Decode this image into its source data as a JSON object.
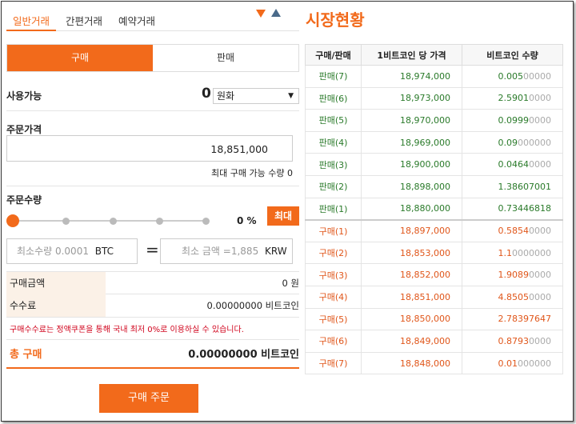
{
  "tabs": [
    {
      "label": "일반거래",
      "active": true
    },
    {
      "label": "간편거래",
      "active": false
    },
    {
      "label": "예약거래",
      "active": false
    }
  ],
  "side_tabs": {
    "buy": "구매",
    "sell": "판매"
  },
  "available": {
    "label": "사용가능",
    "value": "0",
    "currency": "원화"
  },
  "price": {
    "label": "주문가격",
    "value": "18,851,000",
    "max_qty_text": "최대 구매 가능 수량 0"
  },
  "quantity": {
    "label": "주문수량",
    "percent": "0 %",
    "max_button": "최대"
  },
  "min_qty": {
    "placeholder": "최소수량 0.0001",
    "unit": "BTC"
  },
  "min_amount": {
    "placeholder": "최소 금액 =1,885",
    "unit": "KRW"
  },
  "equals": "=",
  "summary": {
    "amount_label": "구매금액",
    "amount_value": "0 원",
    "fee_label": "수수료",
    "fee_value": "0.00000000 비트코인",
    "notice": "구매수수료는 정액쿠폰을 통해 국내 최저 0%로 이용하실 수 있습니다.",
    "total_label": "총 구매",
    "total_value": "0.00000000 비트코인"
  },
  "order_button": "구매 주문",
  "market": {
    "title": "시장현황",
    "headers": [
      "구매/판매",
      "1비트코인 당 가격",
      "비트코인 수량"
    ],
    "sells": [
      {
        "side": "판매(7)",
        "price": "18,974,000",
        "qty": "0.005",
        "qty_dim": "00000"
      },
      {
        "side": "판매(6)",
        "price": "18,973,000",
        "qty": "2.5901",
        "qty_dim": "0000"
      },
      {
        "side": "판매(5)",
        "price": "18,970,000",
        "qty": "0.0999",
        "qty_dim": "0000"
      },
      {
        "side": "판매(4)",
        "price": "18,969,000",
        "qty": "0.09",
        "qty_dim": "000000"
      },
      {
        "side": "판매(3)",
        "price": "18,900,000",
        "qty": "0.0464",
        "qty_dim": "0000"
      },
      {
        "side": "판매(2)",
        "price": "18,898,000",
        "qty": "1.38607001",
        "qty_dim": ""
      },
      {
        "side": "판매(1)",
        "price": "18,880,000",
        "qty": "0.73446818",
        "qty_dim": ""
      }
    ],
    "buys": [
      {
        "side": "구매(1)",
        "price": "18,897,000",
        "qty": "0.5854",
        "qty_dim": "0000"
      },
      {
        "side": "구매(2)",
        "price": "18,853,000",
        "qty": "1.1",
        "qty_dim": "0000000"
      },
      {
        "side": "구매(3)",
        "price": "18,852,000",
        "qty": "1.9089",
        "qty_dim": "0000"
      },
      {
        "side": "구매(4)",
        "price": "18,851,000",
        "qty": "4.8505",
        "qty_dim": "0000"
      },
      {
        "side": "구매(5)",
        "price": "18,850,000",
        "qty": "2.78397647",
        "qty_dim": ""
      },
      {
        "side": "구매(6)",
        "price": "18,849,000",
        "qty": "0.8793",
        "qty_dim": "0000"
      },
      {
        "side": "구매(7)",
        "price": "18,848,000",
        "qty": "0.01",
        "qty_dim": "000000"
      }
    ]
  },
  "colors": {
    "accent": "#f26a1b",
    "sell_text": "#2a7a2a",
    "buy_text": "#e0561a"
  }
}
